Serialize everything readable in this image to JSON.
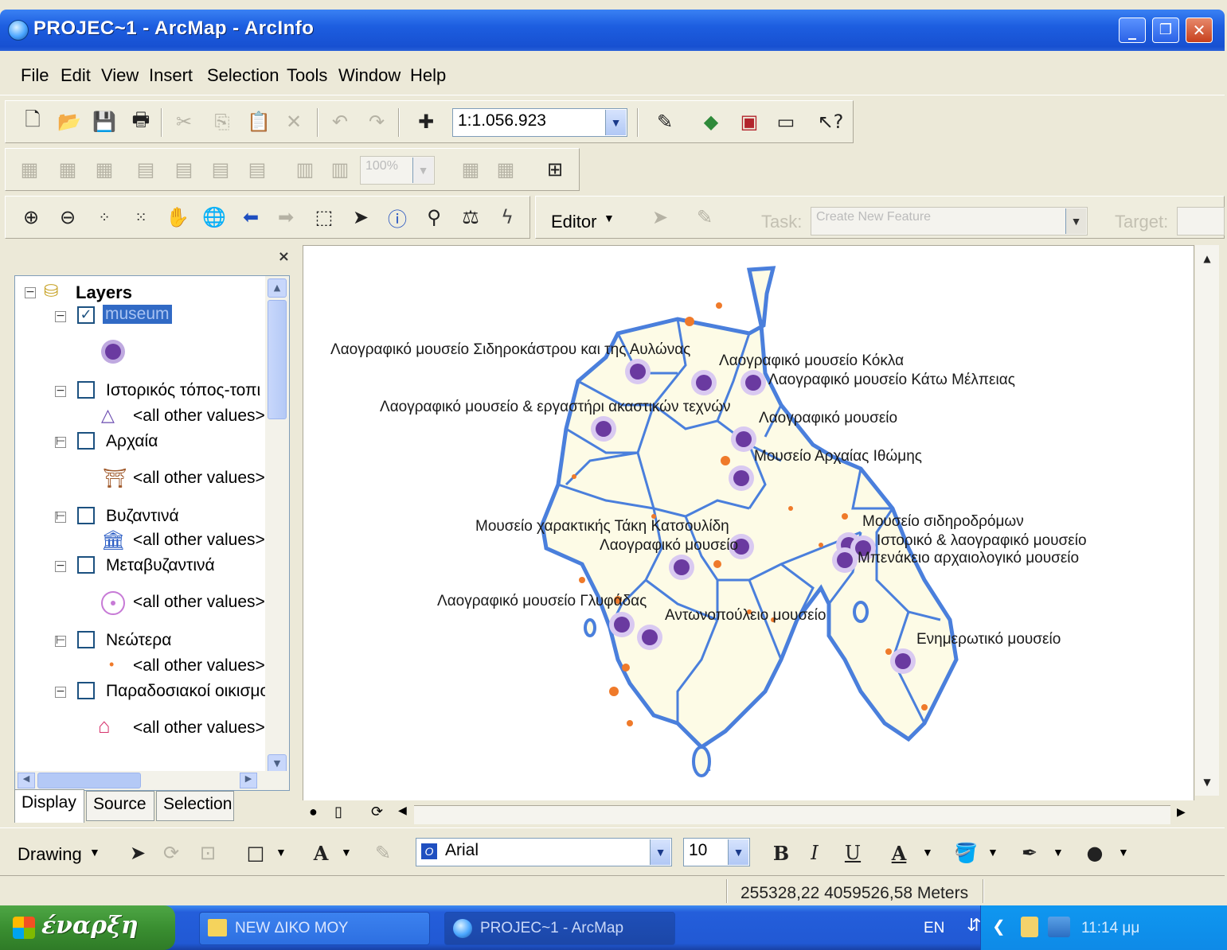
{
  "window": {
    "title": "PROJEC~1 - ArcMap - ArcInfo",
    "controls": {
      "minimize": "_",
      "maximize": "❐",
      "close": "✕"
    }
  },
  "menu": [
    "File",
    "Edit",
    "View",
    "Insert",
    "Selection",
    "Tools",
    "Window",
    "Help"
  ],
  "standard_toolbar": {
    "scale": "1:1.056.923"
  },
  "layout_toolbar": {
    "zoom_percent": "100%"
  },
  "tools_toolbar": {
    "editor_label": "Editor",
    "task_label": "Task:",
    "task_value": "Create New Feature",
    "target_label": "Target:"
  },
  "toc": {
    "root": "Layers",
    "layers": [
      {
        "name": "museum",
        "checked": true,
        "selected": true,
        "legend": ""
      },
      {
        "name": "Ιστορικός τόπος-τοπι",
        "checked": false,
        "legend": "<all other values>"
      },
      {
        "name": "Αρχαία",
        "checked": false,
        "legend": "<all other values>"
      },
      {
        "name": "Βυζαντινά",
        "checked": false,
        "legend": "<all other values>"
      },
      {
        "name": "Μεταβυζαντινά",
        "checked": false,
        "legend": "<all other values>"
      },
      {
        "name": "Νεώτερα",
        "checked": false,
        "legend": "<all other values>"
      },
      {
        "name": "Παραδοσιακοί οικισμο",
        "checked": false,
        "legend": "<all other values>"
      }
    ],
    "tabs": [
      "Display",
      "Source",
      "Selection"
    ],
    "close": "×"
  },
  "map": {
    "labels": [
      "Λαογραφικό μουσείο Σιδηροκάστρου και της Αυλώνας",
      "Λαογραφικό μουσείο Κόκλα",
      "Λαογραφικό μουσείο Κάτω Μέλπειας",
      "Λαογραφικό μουσείο & εργαστήρι ακαστικών τεχνών",
      "Λαογραφικό μουσείο",
      "Μουσείο Αρχαίας Ιθώμης",
      "Μουσείο χαρακτικής Τάκη Κατσουλίδη",
      "Λαογραφικό μουσείο",
      "Μουσείο σιδηροδρόμων",
      "Ιστορικό & λαογραφικό μουσείο",
      "Μπενάκειο αρχαιολογικό μουσείο",
      "Λαογραφικό μουσείο Γλυφάδας",
      "Αντωνοπούλειο μουσείο",
      "Ενημερωτικό μουσείο"
    ],
    "colors": {
      "border": "#4a7fdc",
      "fill": "#fdfbe6",
      "point": "#6a3aa0",
      "spots": "#ef7a2a"
    }
  },
  "drawing_toolbar": {
    "drawing_label": "Drawing",
    "font": "Arial",
    "font_size": "10",
    "bold": "B",
    "italic": "I",
    "underline": "U",
    "text_color": "A"
  },
  "status_bar": {
    "coordinates": "255328,22  4059526,58 Meters"
  },
  "taskbar": {
    "start": "έναρξη",
    "tasks": [
      "NEW ΔΙΚΟ ΜΟΥ",
      "PROJEC~1 - ArcMap"
    ],
    "lang": "EN",
    "clock": "11:14 μμ"
  }
}
